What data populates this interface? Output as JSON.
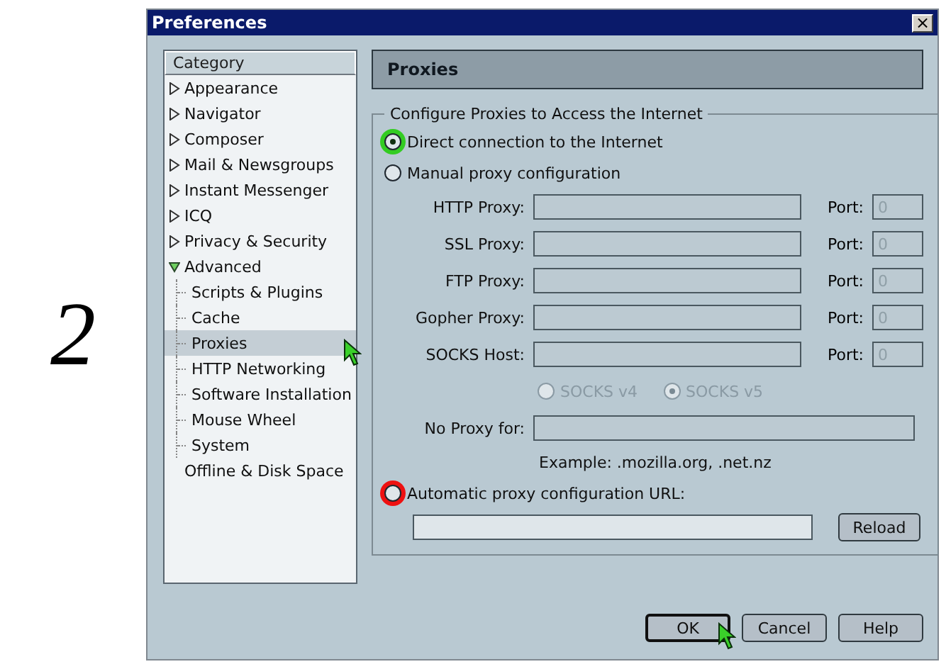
{
  "step_number": "2",
  "window": {
    "title": "Preferences",
    "close": "×"
  },
  "sidebar": {
    "header": "Category",
    "items": [
      {
        "label": "Appearance",
        "expanded": false,
        "selected": false
      },
      {
        "label": "Navigator",
        "expanded": false,
        "selected": false
      },
      {
        "label": "Composer",
        "expanded": false,
        "selected": false
      },
      {
        "label": "Mail & Newsgroups",
        "expanded": false,
        "selected": false
      },
      {
        "label": "Instant Messenger",
        "expanded": false,
        "selected": false
      },
      {
        "label": "ICQ",
        "expanded": false,
        "selected": false
      },
      {
        "label": "Privacy & Security",
        "expanded": false,
        "selected": false
      },
      {
        "label": "Advanced",
        "expanded": true,
        "selected": false,
        "children": [
          {
            "label": "Scripts & Plugins",
            "selected": false
          },
          {
            "label": "Cache",
            "selected": false
          },
          {
            "label": "Proxies",
            "selected": true,
            "pointer": true
          },
          {
            "label": "HTTP Networking",
            "selected": false
          },
          {
            "label": "Software Installation",
            "selected": false
          },
          {
            "label": "Mouse Wheel",
            "selected": false
          },
          {
            "label": "System",
            "selected": false
          }
        ]
      },
      {
        "label": "Offline & Disk Space",
        "leaf": true,
        "expanded": false,
        "selected": false
      }
    ]
  },
  "panel": {
    "title": "Proxies",
    "group_title": "Configure Proxies to Access the Internet",
    "modes": [
      {
        "label": "Direct connection to the Internet",
        "selected": true,
        "color": "#33cc22"
      },
      {
        "label": "Manual proxy configuration",
        "selected": false
      }
    ],
    "manual": {
      "disabled": true,
      "proxies": [
        {
          "label": "HTTP Proxy:",
          "port_label": "Port:",
          "port": "0"
        },
        {
          "label": "SSL Proxy:",
          "port_label": "Port:",
          "port": "0"
        },
        {
          "label": "FTP Proxy:",
          "port_label": "Port:",
          "port": "0"
        },
        {
          "label": "Gopher Proxy:",
          "port_label": "Port:",
          "port": "0"
        },
        {
          "label": "SOCKS Host:",
          "port_label": "Port:",
          "port": "0"
        }
      ],
      "socks_versions": [
        {
          "label": "SOCKS v4",
          "selected": false
        },
        {
          "label": "SOCKS v5",
          "selected": true
        }
      ],
      "no_proxy": {
        "label": "No Proxy for:"
      },
      "example": "Example: .mozilla.org, .net.nz"
    },
    "auto": {
      "label": "Automatic proxy configuration URL:",
      "selected": false,
      "color": "#ee1111",
      "reload": "Reload"
    }
  },
  "buttons": [
    {
      "label": "OK",
      "default": true,
      "pointer": true
    },
    {
      "label": "Cancel",
      "default": false
    },
    {
      "label": "Help",
      "default": false
    }
  ]
}
